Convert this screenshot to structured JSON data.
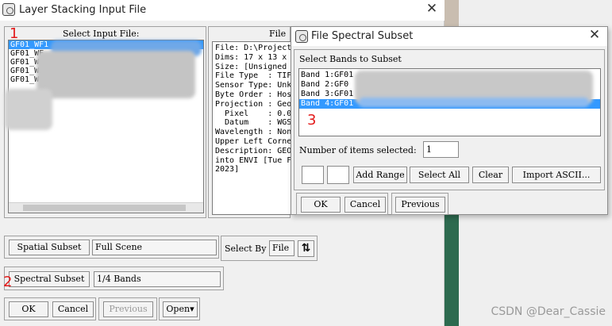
{
  "main_window": {
    "title": "Layer Stacking Input File",
    "close_glyph": "✕",
    "input_list": {
      "header": "Select Input File:",
      "files": [
        "GF01_WF1",
        "GF01_WF",
        "GF01_W",
        "GF01_WI",
        "GF01_W"
      ]
    },
    "file_info": {
      "header": "File",
      "lines": [
        "File: D:\\Project",
        "Dims: 17 x 13 x",
        "Size: [Unsigned",
        "File Type  : TIF",
        "Sensor Type: Unk",
        "Byte Order : Hos",
        "Projection : Geo",
        "  Pixel    : 0.0",
        "  Datum    : WGS",
        "Wavelength : Non",
        "Upper Left Corne",
        "Description: GEO",
        "into ENVI [Tue F",
        "2023]"
      ]
    },
    "spatial_subset": {
      "button": "Spatial Subset",
      "value": "Full Scene"
    },
    "select_by": {
      "label": "Select By",
      "value": "File",
      "sort_icon": "⇅"
    },
    "spectral_subset": {
      "button": "Spectral Subset",
      "value": "1/4 Bands"
    },
    "buttons": {
      "ok": "OK",
      "cancel": "Cancel",
      "previous": "Previous",
      "open": "Open",
      "open_arrow": "▾"
    },
    "markers": {
      "m1": "1",
      "m2": "2"
    }
  },
  "dialog": {
    "title": "File Spectral Subset",
    "close_glyph": "✕",
    "prompt": "Select Bands to Subset",
    "bands": [
      "Band 1:GF01",
      "Band 2:GF0",
      "Band 3:GF01",
      "Band 4:GF01"
    ],
    "selected_band_index": 3,
    "items_selected_label": "Number of items selected:",
    "items_selected_value": "1",
    "range_buttons": {
      "add_range": "Add Range",
      "select_all": "Select All",
      "clear": "Clear",
      "import_ascii": "Import ASCII..."
    },
    "buttons": {
      "ok": "OK",
      "cancel": "Cancel",
      "previous": "Previous"
    },
    "marker3": "3"
  },
  "watermark": "CSDN @Dear_Cassie",
  "colors": {
    "selection": "#3399ff",
    "marker": "#e31b1b",
    "window_bg": "#f0f0f0"
  },
  "icons": {
    "app": "envi-app-icon",
    "close": "close-icon",
    "sort": "sort-icon",
    "dropdown": "dropdown-arrow-icon"
  }
}
